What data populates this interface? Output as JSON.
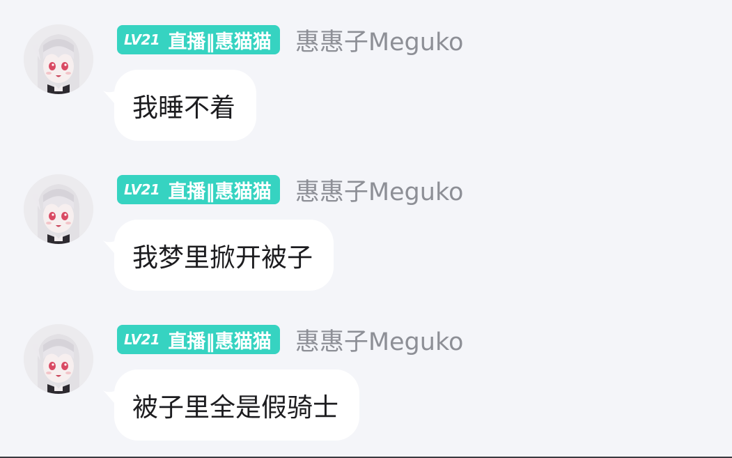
{
  "theme": {
    "background": "#f4f5f9",
    "badge_color": "#36d3c1",
    "username_color": "#8d8f96",
    "bubble_color": "#ffffff"
  },
  "messages": [
    {
      "badge_level": "LV21",
      "badge_text": "直播‖惠猫猫",
      "username": "惠惠子Meguko",
      "text": "我睡不着"
    },
    {
      "badge_level": "LV21",
      "badge_text": "直播‖惠猫猫",
      "username": "惠惠子Meguko",
      "text": "我梦里掀开被子"
    },
    {
      "badge_level": "LV21",
      "badge_text": "直播‖惠猫猫",
      "username": "惠惠子Meguko",
      "text": "被子里全是假骑士"
    }
  ]
}
